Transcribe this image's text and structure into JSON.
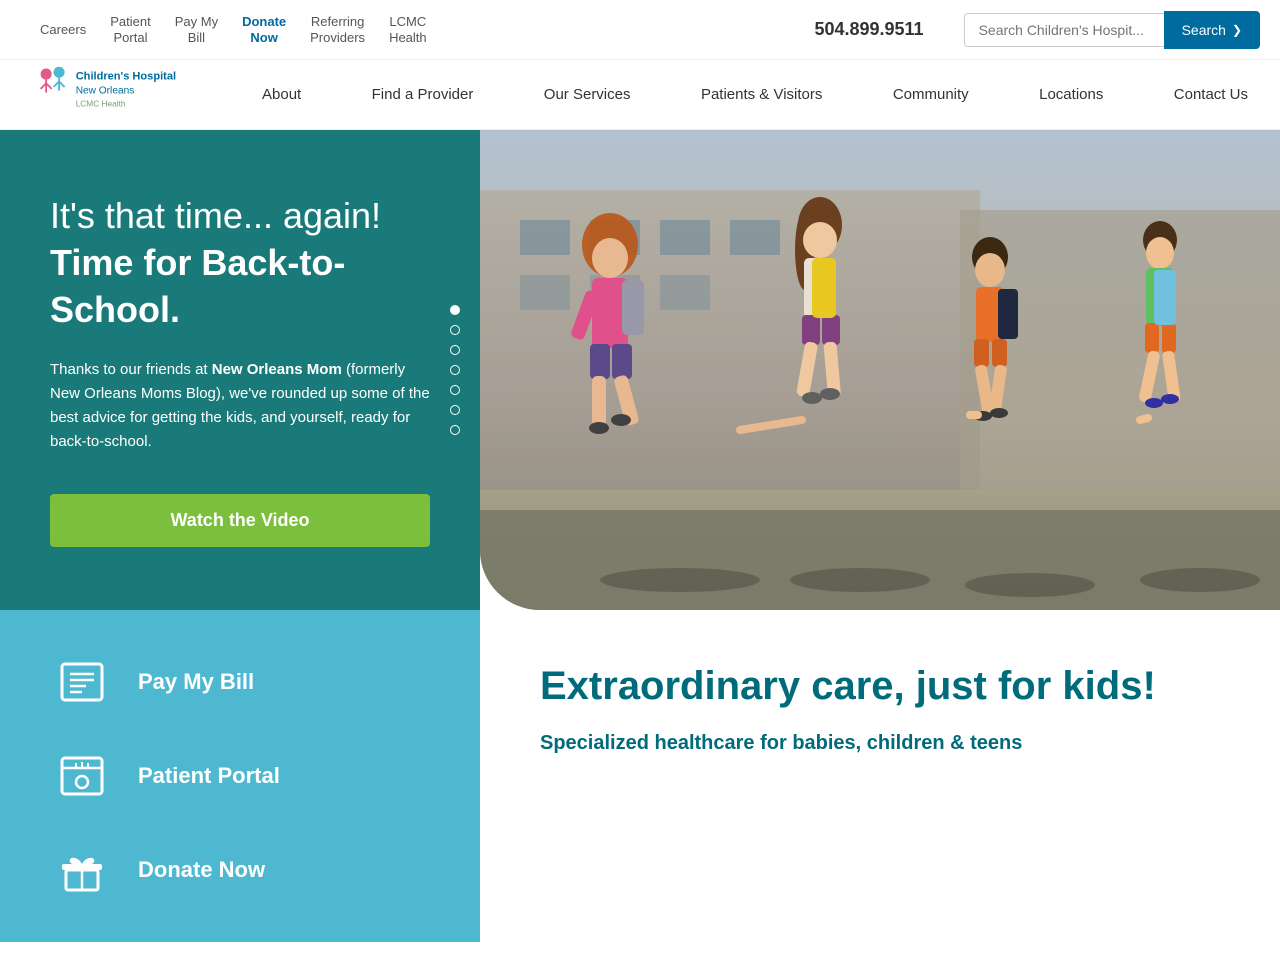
{
  "topbar": {
    "links": [
      {
        "id": "careers",
        "label": "Careers"
      },
      {
        "id": "patient-portal",
        "label": "Patient\nPortal"
      },
      {
        "id": "pay-my-bill",
        "label": "Pay My\nBill"
      },
      {
        "id": "donate-now",
        "label": "Donate\nNow"
      },
      {
        "id": "referring-providers",
        "label": "Referring\nProviders"
      },
      {
        "id": "lcmc-health",
        "label": "LCMC\nHealth"
      }
    ],
    "phone": "504.899.9511",
    "search_placeholder": "Search Children's Hospit...",
    "search_label": "Search"
  },
  "nav": {
    "logo_line1": "Children's Hospital",
    "logo_line2": "New Orleans",
    "logo_line3": "LCMC Health",
    "items": [
      {
        "id": "about",
        "label": "About"
      },
      {
        "id": "find-provider",
        "label": "Find a Provider"
      },
      {
        "id": "our-services",
        "label": "Our Services"
      },
      {
        "id": "patients-visitors",
        "label": "Patients & Visitors"
      },
      {
        "id": "community",
        "label": "Community"
      },
      {
        "id": "locations",
        "label": "Locations"
      },
      {
        "id": "contact-us",
        "label": "Contact Us"
      }
    ]
  },
  "hero": {
    "title_normal": "It's that time... again! ",
    "title_bold": "Time for Back-to-School.",
    "body_prefix": "Thanks to our friends at ",
    "body_brand": "New Orleans Mom",
    "body_suffix": " (formerly New Orleans Moms Blog), we've rounded up some of the best advice for getting the kids, and yourself, ready for back-to-school.",
    "watch_btn": "Watch the Video",
    "dots": [
      {
        "active": true
      },
      {
        "active": false
      },
      {
        "active": false
      },
      {
        "active": false
      },
      {
        "active": false
      },
      {
        "active": false
      },
      {
        "active": false
      }
    ]
  },
  "bottom_left": {
    "cards": [
      {
        "id": "pay-bill",
        "label": "Pay My Bill",
        "icon": "bill"
      },
      {
        "id": "patient-portal",
        "label": "Patient Portal",
        "icon": "portal"
      },
      {
        "id": "donate",
        "label": "Donate Now",
        "icon": "gift"
      }
    ]
  },
  "bottom_right": {
    "title": "Extraordinary care, just for kids!",
    "subtitle": "Specialized healthcare for babies, children & teens"
  }
}
